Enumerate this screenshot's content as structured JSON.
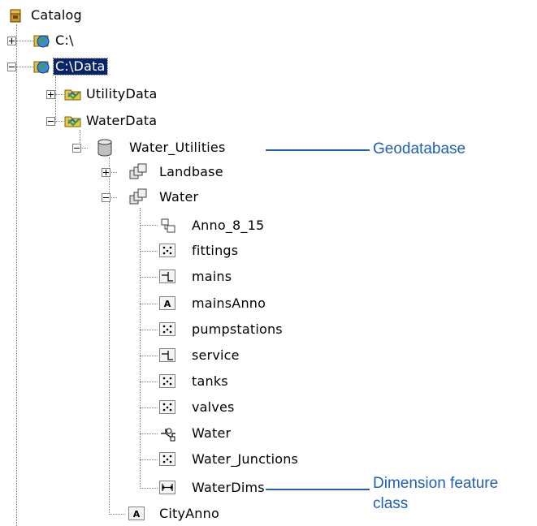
{
  "tree": {
    "root": "Catalog",
    "drive_c": "C:\\",
    "data": "C:\\Data",
    "utility_data": "UtilityData",
    "water_data": "WaterData",
    "geodatabase": "Water_Utilities",
    "landbase": "Landbase",
    "water_ds": "Water",
    "items": [
      "Anno_8_15",
      "fittings",
      "mains",
      "mainsAnno",
      "pumpstations",
      "service",
      "tanks",
      "valves",
      "Water",
      "Water_Junctions",
      "WaterDims"
    ],
    "city_anno": "CityAnno"
  },
  "callouts": {
    "geodatabase": "Geodatabase",
    "dimension_line1": "Dimension feature",
    "dimension_line2": "class"
  },
  "colors": {
    "callout": "#1f5fb4",
    "selection": "#0a246a"
  }
}
